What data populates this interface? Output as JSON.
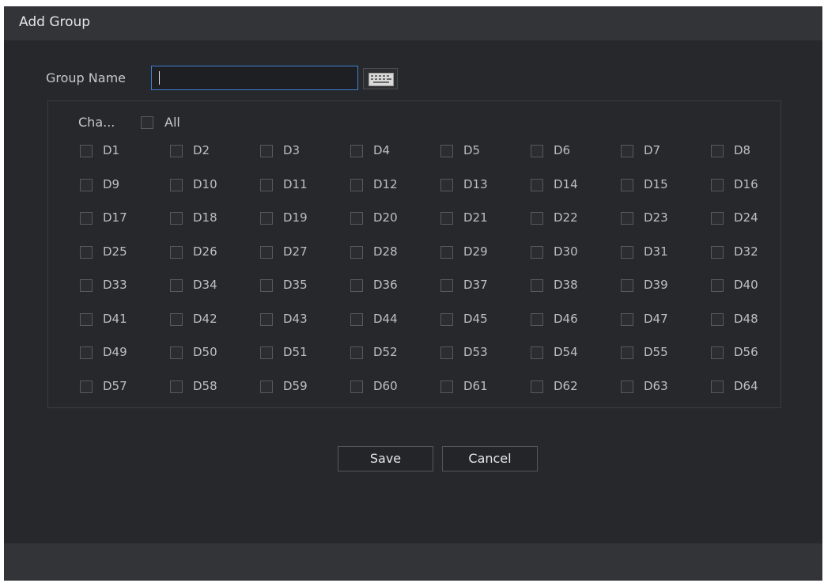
{
  "dialog": {
    "title": "Add Group",
    "group_name_label": "Group Name",
    "group_name_value": "",
    "channel_label": "Cha...",
    "all_label": "All",
    "channels": [
      "D1",
      "D2",
      "D3",
      "D4",
      "D5",
      "D6",
      "D7",
      "D8",
      "D9",
      "D10",
      "D11",
      "D12",
      "D13",
      "D14",
      "D15",
      "D16",
      "D17",
      "D18",
      "D19",
      "D20",
      "D21",
      "D22",
      "D23",
      "D24",
      "D25",
      "D26",
      "D27",
      "D28",
      "D29",
      "D30",
      "D31",
      "D32",
      "D33",
      "D34",
      "D35",
      "D36",
      "D37",
      "D38",
      "D39",
      "D40",
      "D41",
      "D42",
      "D43",
      "D44",
      "D45",
      "D46",
      "D47",
      "D48",
      "D49",
      "D50",
      "D51",
      "D52",
      "D53",
      "D54",
      "D55",
      "D56",
      "D57",
      "D58",
      "D59",
      "D60",
      "D61",
      "D62",
      "D63",
      "D64"
    ],
    "save_label": "Save",
    "cancel_label": "Cancel"
  },
  "icons": {
    "keyboard": "keyboard-icon"
  },
  "colors": {
    "background": "#26282c",
    "titlebar": "#323438",
    "input_focus_border": "#3f7fd1"
  }
}
